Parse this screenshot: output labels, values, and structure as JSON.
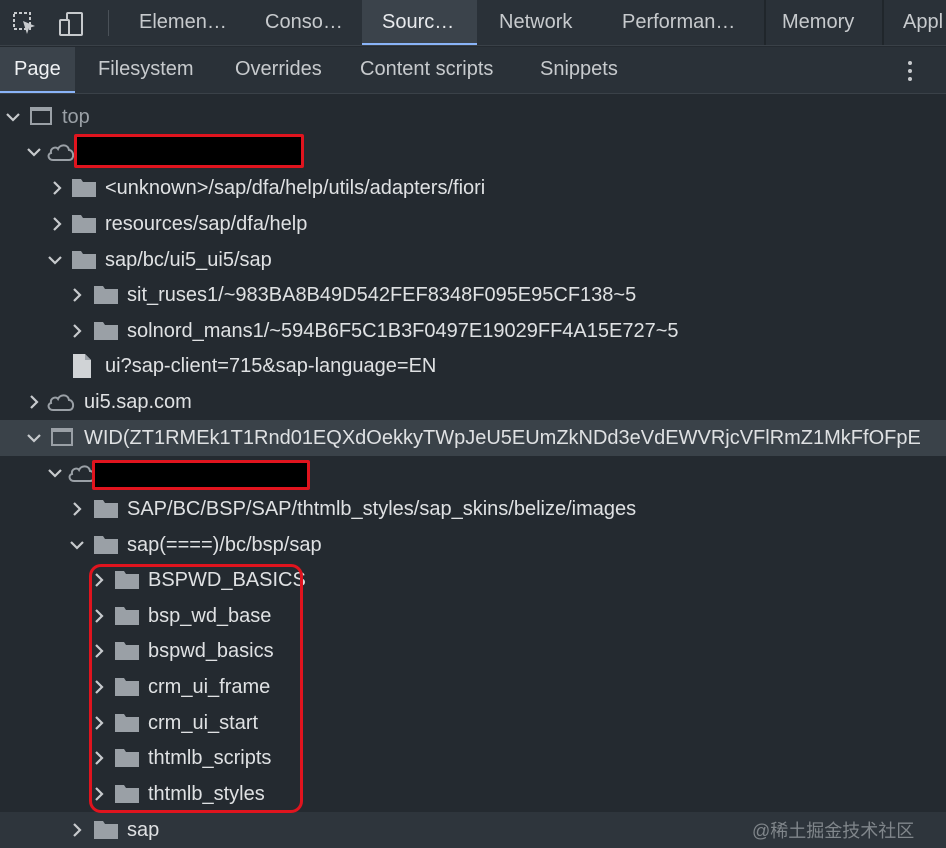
{
  "tabs": [
    "Elemen…",
    "Conso…",
    "Sourc…",
    "Network",
    "Performan…",
    "Memory",
    "Appl"
  ],
  "subtabs": [
    "Page",
    "Filesystem",
    "Overrides",
    "Content scripts",
    "Snippets"
  ],
  "tree": {
    "top": "top",
    "folder_a1": "<unknown>/sap/dfa/help/utils/adapters/fiori",
    "folder_a2": "resources/sap/dfa/help",
    "folder_a3": "sap/bc/ui5_ui5/sap",
    "folder_a3_1": "sit_ruses1/~983BA8B49D542FEF8348F095E95CF138~5",
    "folder_a3_2": "solnord_mans1/~594B6F5C1B3F0497E19029FF4A15E727~5",
    "file_a4": "ui?sap-client=715&sap-language=EN",
    "origin_ui5": "ui5.sap.com",
    "frame_wid": "WID(ZT1RMEk1T1Rnd01EQXdOekkyTWpJeU5EUmZkNDd3eVdEWVRjcVFlRmZ1MkFfOFpE",
    "folder_b1": "SAP/BC/BSP/SAP/thtmlb_styles/sap_skins/belize/images",
    "folder_b2": "sap(====)/bc/bsp/sap",
    "children": [
      "BSPWD_BASICS",
      "bsp_wd_base",
      "bspwd_basics",
      "crm_ui_frame",
      "crm_ui_start",
      "thtmlb_scripts",
      "thtmlb_styles"
    ],
    "folder_b3": "sap"
  },
  "watermark": "@稀土掘金技术社区"
}
